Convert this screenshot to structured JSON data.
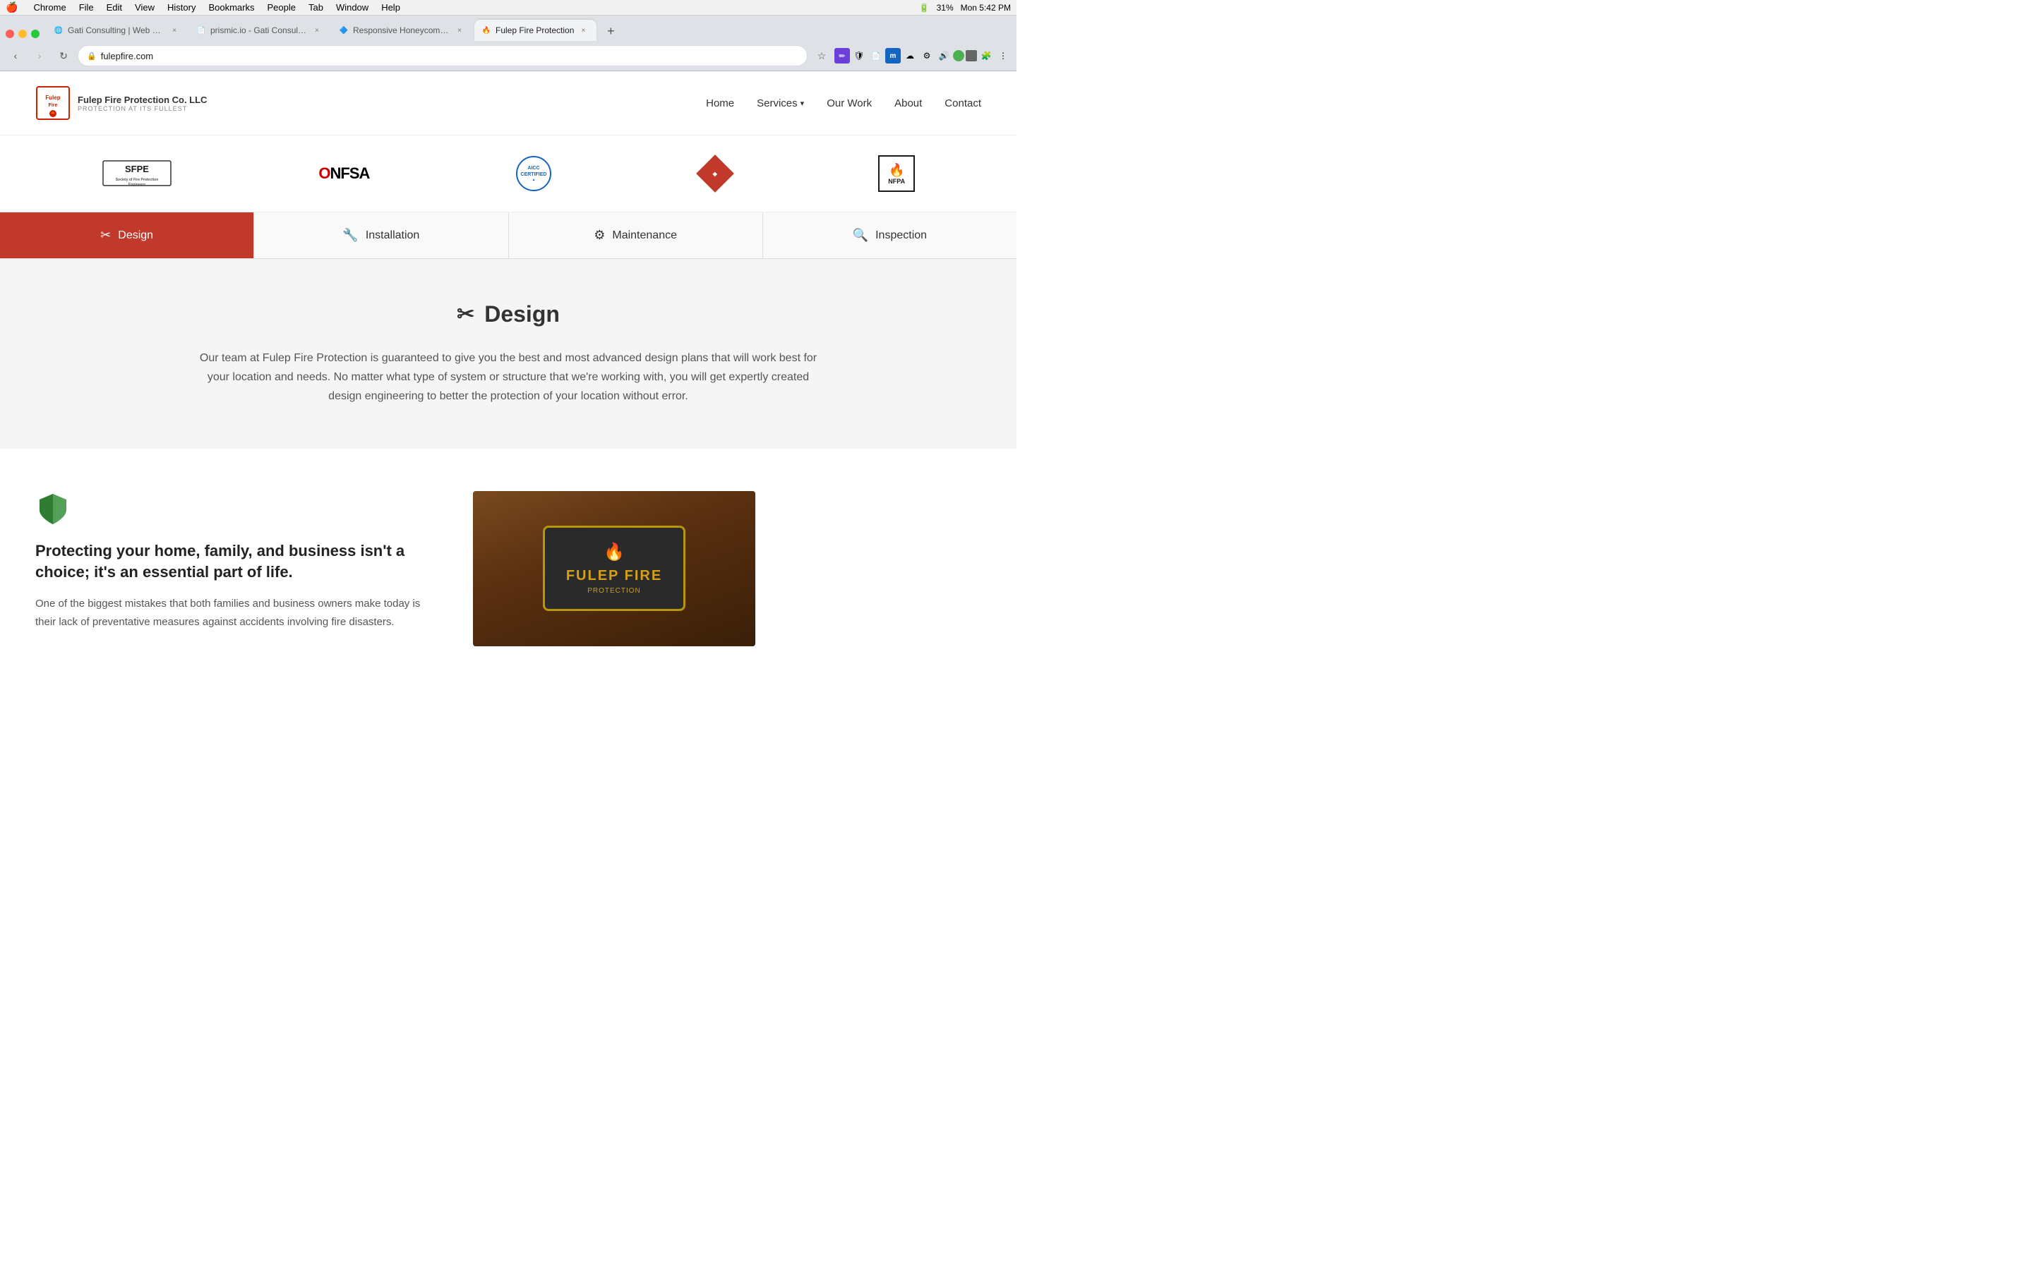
{
  "macos": {
    "apple": "🍎",
    "menu_items": [
      "Chrome",
      "File",
      "Edit",
      "View",
      "History",
      "Bookmarks",
      "People",
      "Tab",
      "Window",
      "Help"
    ],
    "time": "Mon 5:42 PM",
    "battery": "31%"
  },
  "tabs": [
    {
      "id": "tab1",
      "title": "Gati Consulting | Web Design &…",
      "active": false,
      "favicon": "🌐"
    },
    {
      "id": "tab2",
      "title": "prismic.io - Gati Consulting LL…",
      "active": false,
      "favicon": "📄"
    },
    {
      "id": "tab3",
      "title": "Responsive Honeycomb Grid …",
      "active": false,
      "favicon": "🔷"
    },
    {
      "id": "tab4",
      "title": "Fulep Fire Protection",
      "active": true,
      "favicon": "🔥"
    }
  ],
  "browser": {
    "url": "fulepfire.com",
    "back_disabled": false,
    "forward_disabled": true
  },
  "site": {
    "logo": {
      "brand": "Fulep Fire Protection Co. LLC",
      "tagline": "PROTECTION AT ITS FULLEST"
    },
    "nav": {
      "home": "Home",
      "services": "Services",
      "our_work": "Our Work",
      "about": "About",
      "contact": "Contact"
    },
    "partners": [
      {
        "name": "SFPE",
        "sub": "Society of Fire Protection Engineers"
      },
      {
        "name": "ONFSA",
        "sub": ""
      },
      {
        "name": "AICC Certified",
        "sub": ""
      },
      {
        "name": "Diamond",
        "sub": ""
      },
      {
        "name": "NFPA",
        "sub": ""
      }
    ],
    "tabs": [
      {
        "id": "design",
        "label": "Design",
        "icon": "✂",
        "active": true
      },
      {
        "id": "installation",
        "label": "Installation",
        "icon": "🔧",
        "active": false
      },
      {
        "id": "maintenance",
        "label": "Maintenance",
        "icon": "⚙",
        "active": false
      },
      {
        "id": "inspection",
        "label": "Inspection",
        "icon": "🔍",
        "active": false
      }
    ],
    "design_section": {
      "title": "Design",
      "title_icon": "✂",
      "description": "Our team at Fulep Fire Protection is guaranteed to give you the best and most advanced design plans that will work best for your location and needs. No matter what type of system or structure that we're working with, you will get expertly created design engineering to better the protection of your location without error."
    },
    "protection": {
      "heading": "Protecting your home, family, and business isn't a choice; it's an essential part of life.",
      "body": "One of the biggest mistakes that both families and business owners make today is their lack of preventative measures against accidents involving fire disasters."
    }
  }
}
